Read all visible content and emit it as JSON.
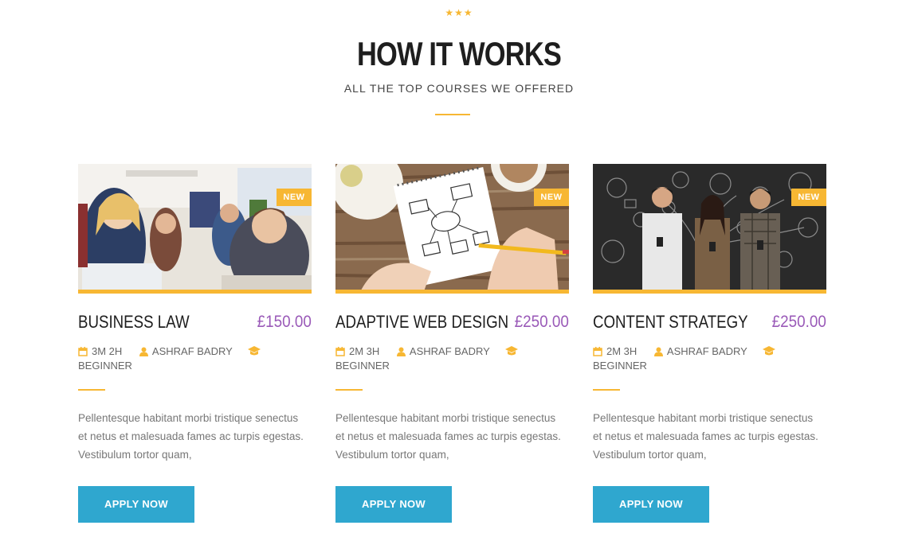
{
  "header": {
    "stars": "★★★",
    "title": "HOW IT WORKS",
    "subtitle": "ALL THE TOP COURSES WE OFFERED"
  },
  "colors": {
    "accent": "#f7b733",
    "price": "#9a5ab8",
    "button": "#2fa7cf"
  },
  "courses": [
    {
      "badge": "NEW",
      "name": "BUSINESS LAW",
      "price": "£150.00",
      "duration": "3M 2H",
      "instructor": "ASHRAF BADRY",
      "level": "BEGINNER",
      "description": "Pellentesque habitant morbi tristique senectus et netus et malesuada fames ac turpis egestas. Vestibulum tortor quam,",
      "button": "APPLY NOW",
      "image": "students-in-classroom-photo"
    },
    {
      "badge": "NEW",
      "name": "ADAPTIVE WEB DESIGN",
      "price": "£250.00",
      "duration": "2M 3H",
      "instructor": "ASHRAF BADRY",
      "level": "BEGINNER",
      "description": "Pellentesque habitant morbi tristique senectus et netus et malesuada fames ac turpis egestas. Vestibulum tortor quam,",
      "button": "APPLY NOW",
      "image": "sketching-wireframe-photo"
    },
    {
      "badge": "NEW",
      "name": "CONTENT STRATEGY",
      "price": "£250.00",
      "duration": "2M 3H",
      "instructor": "ASHRAF BADRY",
      "level": "BEGINNER",
      "description": "Pellentesque habitant morbi tristique senectus et netus et malesuada fames ac turpis egestas. Vestibulum tortor quam,",
      "button": "APPLY NOW",
      "image": "people-with-phones-chalkboard-photo"
    }
  ]
}
